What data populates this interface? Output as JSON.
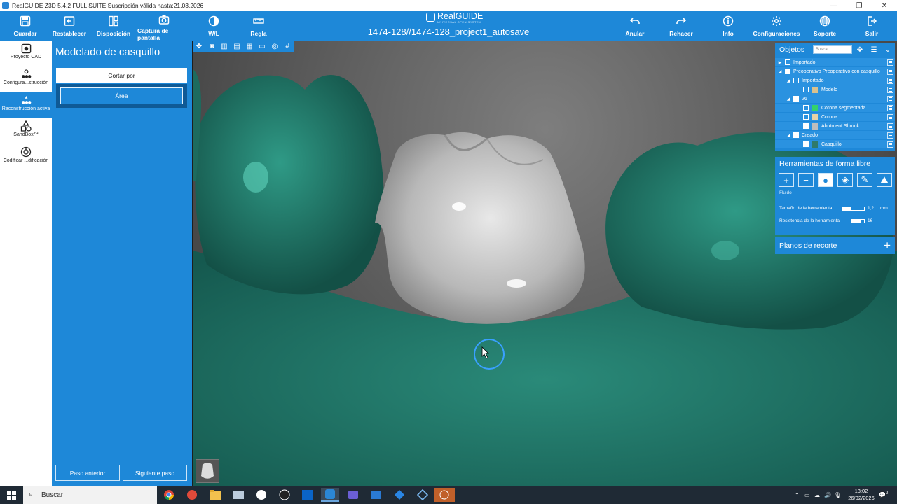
{
  "window": {
    "title": "RealGUIDE Z3D  5.4.2  FULL SUITE Suscripción válida hasta:21.03.2026",
    "minimize": "—",
    "maximize": "❐",
    "close": "✕"
  },
  "toolbar": {
    "save": "Guardar",
    "reset": "Restablecer",
    "layout": "Disposición",
    "screenshot": "Captura de pantalla",
    "wl": "W/L",
    "ruler": "Regla",
    "undo": "Anular",
    "redo": "Rehacer",
    "info": "Info",
    "settings": "Configuraciones",
    "support": "Soporte",
    "exit": "Salir"
  },
  "logo": {
    "name": "RealGUIDE",
    "tagline": "UNIVERSAL OPEN SYSTEM"
  },
  "project_title": "1474-128//1474-128_project1_autosave",
  "rail": [
    {
      "label": "Proyecto CAD",
      "icon": "cad-project-icon"
    },
    {
      "label": "Configura...strucción",
      "icon": "reconstruction-config-icon"
    },
    {
      "label": "Reconstrucción activa",
      "icon": "active-reconstruction-icon"
    },
    {
      "label": "SandBox™",
      "icon": "sandbox-shapes-icon"
    },
    {
      "label": "Codificar ...dificación",
      "icon": "coding-icon"
    }
  ],
  "workflow": {
    "title": "Modelado de casquillo",
    "tab": "Cortar por",
    "option": "Área",
    "prev": "Paso anterior",
    "next": "Siguiente paso"
  },
  "objects": {
    "title": "Objetos",
    "search_placeholder": "Buscar",
    "rows": [
      {
        "label": "Importado",
        "checked": false,
        "swatch": ""
      },
      {
        "label": "Preoperativo Preoperativo con casquillo",
        "checked": true,
        "swatch": ""
      },
      {
        "label": "Importado",
        "checked": false,
        "swatch": ""
      },
      {
        "label": "Modelo",
        "checked": false,
        "swatch": "#d9c18e"
      },
      {
        "label": "26",
        "checked": true,
        "swatch": ""
      },
      {
        "label": "Corona segmentada",
        "checked": false,
        "swatch": "#34d26a"
      },
      {
        "label": "Corona",
        "checked": false,
        "swatch": "#e6d2a6"
      },
      {
        "label": "Abutment Shrunk",
        "checked": true,
        "swatch": "#bdbdbd"
      },
      {
        "label": "Creado",
        "checked": true,
        "swatch": ""
      },
      {
        "label": "Casquillo",
        "checked": true,
        "swatch": "#2f7a6a"
      }
    ]
  },
  "freeform": {
    "title": "Herramientas de forma libre",
    "mode": "Fluido",
    "size_label": "Tamaño de la herramienta",
    "size_value": "1,2",
    "size_unit": "mm",
    "size_fill": 0.35,
    "strength_label": "Resistencia de la herramienta",
    "strength_value": "16",
    "strength_fill": 0.75
  },
  "cut_planes": {
    "title": "Planos de recorte"
  },
  "taskbar": {
    "search": "Buscar",
    "time": "13:02",
    "date": "26/02/2026",
    "notifications": "2"
  },
  "colors": {
    "accent": "#1e88d8",
    "gum": "#1f7366",
    "abutment": "#c9c9c9"
  }
}
